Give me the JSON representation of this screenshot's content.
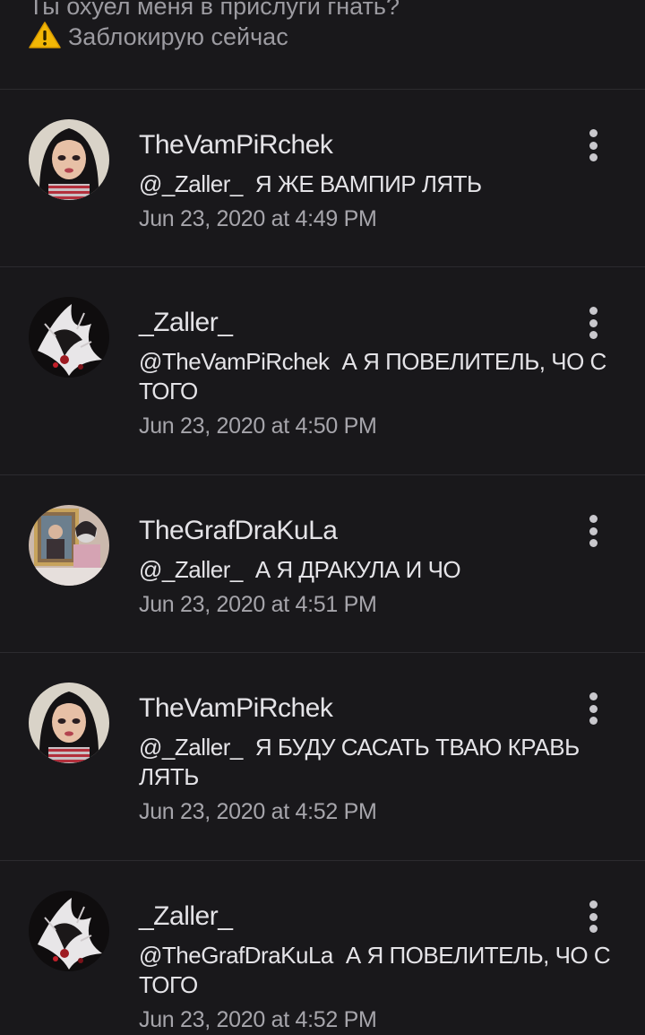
{
  "previous_message": {
    "line1": "Ты охуел меня в прислуги гнать?",
    "line2": "Заблокирую сейчас",
    "icon": "warning-icon"
  },
  "comments": [
    {
      "username": "TheVamPiRchek",
      "mention": "@_Zaller_",
      "text": "Я ЖЕ ВАМПИР ЛЯТЬ",
      "timestamp": "Jun 23, 2020 at 4:49 PM",
      "avatar": "doll-avatar"
    },
    {
      "username": "_Zaller_",
      "mention": "@TheVamPiRchek",
      "text": "А Я ПОВЕЛИТЕЛЬ, ЧО С ТОГО",
      "timestamp": "Jun 23, 2020 at 4:50 PM",
      "avatar": "dark-art-avatar"
    },
    {
      "username": "TheGrafDraKuLa",
      "mention": "@_Zaller_",
      "text": "А Я ДРАКУЛА И ЧО",
      "timestamp": "Jun 23, 2020 at 4:51 PM",
      "avatar": "photo-avatar"
    },
    {
      "username": "TheVamPiRchek",
      "mention": "@_Zaller_",
      "text": "Я БУДУ САСАТЬ ТВАЮ КРАВЬ ЛЯТЬ",
      "timestamp": "Jun 23, 2020 at 4:52 PM",
      "avatar": "doll-avatar"
    },
    {
      "username": "_Zaller_",
      "mention": "@TheGrafDraKuLa",
      "text": "А Я ПОВЕЛИТЕЛЬ, ЧО С ТОГО",
      "timestamp": "Jun 23, 2020 at 4:52 PM",
      "avatar": "dark-art-avatar"
    }
  ],
  "colors": {
    "background": "#19181b",
    "text_primary": "#e4e3e7",
    "text_secondary": "#a6a5ab",
    "divider": "#2c2b2f"
  }
}
